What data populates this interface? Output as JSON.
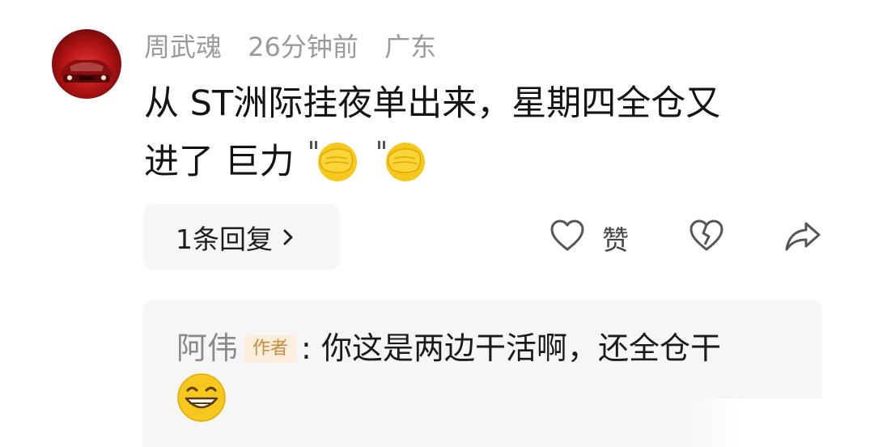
{
  "comment": {
    "username": "周武魂",
    "time": "26分钟前",
    "location": "广东",
    "text_line1": "从 ST洲际挂夜单出来，星期四全仓又",
    "text_line2": "进了 巨力",
    "emojis": [
      "facepalm-emoji",
      "facepalm-emoji"
    ]
  },
  "replies_button": {
    "label": "1条回复"
  },
  "actions": {
    "like_label": "赞",
    "icons": [
      "heart-icon",
      "broken-heart-icon",
      "share-arrow-icon"
    ]
  },
  "reply": {
    "author": "阿伟",
    "badge": "作者",
    "separator": ":",
    "text": "你这是两边干活啊，还全仓干",
    "emoji": "grinning-emoji"
  },
  "colors": {
    "meta_gray": "#9a9a9a",
    "badge_bg": "#fbeedd",
    "badge_text": "#c98a3a",
    "panel_bg": "#f6f6f6",
    "avatar_red": "#b31414"
  }
}
